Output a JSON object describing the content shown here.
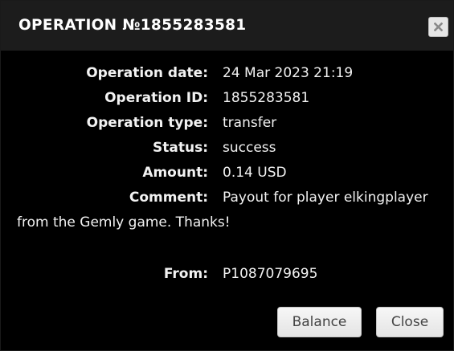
{
  "dialog": {
    "title": "OPERATION №1855283581",
    "close_icon": "close-x-icon"
  },
  "details": {
    "rows": [
      {
        "label": "Operation date:",
        "value": "24 Mar 2023 21:19"
      },
      {
        "label": "Operation ID:",
        "value": "1855283581"
      },
      {
        "label": "Operation type:",
        "value": "transfer"
      },
      {
        "label": "Status:",
        "value": "success"
      },
      {
        "label": "Amount:",
        "value": "0.14 USD"
      },
      {
        "label": "Comment:",
        "value": "Payout for player elkingplayer"
      }
    ],
    "comment_continuation": "from the Gemly game. Thanks!",
    "from": {
      "label": "From:",
      "value": "P1087079695"
    }
  },
  "buttons": {
    "balance_label": "Balance",
    "close_label": "Close"
  }
}
